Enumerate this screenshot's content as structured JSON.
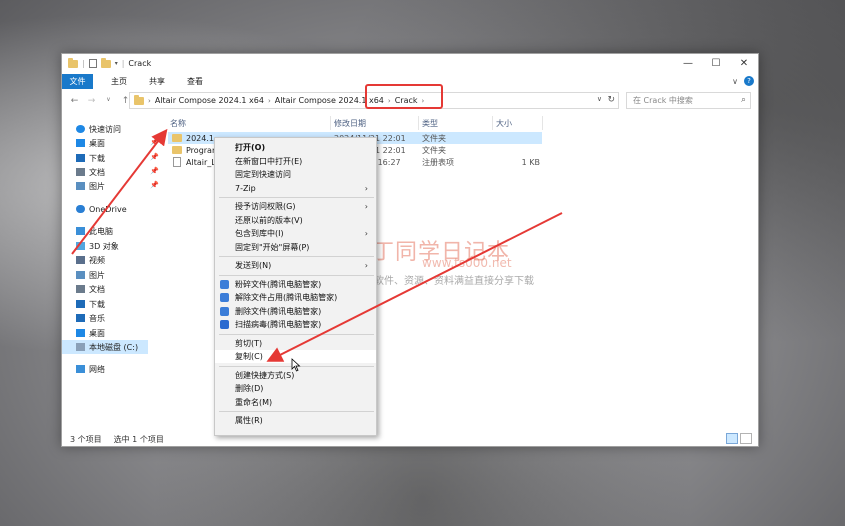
{
  "window": {
    "title": "Crack",
    "controls": {
      "minimize": "—",
      "maximize": "☐",
      "close": "✕"
    }
  },
  "ribbon": {
    "tabs": [
      "文件",
      "主页",
      "共享",
      "查看"
    ],
    "expand_icon": "∨",
    "help_icon": "?"
  },
  "address": {
    "crumbs": [
      "Altair Compose 2024.1 x64",
      "Altair Compose 2024.1 x64",
      "Crack"
    ],
    "search_placeholder": "在 Crack 中搜索"
  },
  "nav_pane": {
    "items": [
      {
        "label": "快速访问",
        "icon": "star-icon",
        "color": "#1e88e5"
      },
      {
        "label": "桌面",
        "icon": "desktop-icon",
        "color": "#1e88e5",
        "pinned": true
      },
      {
        "label": "下载",
        "icon": "download-icon",
        "color": "#1e6bb8",
        "pinned": true
      },
      {
        "label": "文档",
        "icon": "document-icon",
        "color": "#6b7b8c",
        "pinned": true
      },
      {
        "label": "图片",
        "icon": "pictures-icon",
        "color": "#5a8fc0",
        "pinned": true
      },
      {
        "label": "OneDrive",
        "icon": "cloud-icon",
        "color": "#2a7fd4"
      },
      {
        "label": "此电脑",
        "icon": "pc-icon",
        "color": "#3a8fd8"
      },
      {
        "label": "3D 对象",
        "icon": "cube-icon",
        "color": "#52a7e0"
      },
      {
        "label": "视频",
        "icon": "video-icon",
        "color": "#5a6f8c"
      },
      {
        "label": "图片",
        "icon": "pictures-icon",
        "color": "#5a8fc0"
      },
      {
        "label": "文档",
        "icon": "document-icon",
        "color": "#6b7b8c"
      },
      {
        "label": "下载",
        "icon": "download-icon",
        "color": "#1e6bb8"
      },
      {
        "label": "音乐",
        "icon": "music-icon",
        "color": "#1e6bb8"
      },
      {
        "label": "桌面",
        "icon": "desktop-icon",
        "color": "#1e88e5"
      },
      {
        "label": "本地磁盘 (C:)",
        "icon": "drive-icon",
        "color": "#8aa0b8",
        "selected": true
      },
      {
        "label": "网络",
        "icon": "network-icon",
        "color": "#3a8fd8"
      }
    ]
  },
  "file_list": {
    "columns": [
      "名称",
      "修改日期",
      "类型",
      "大小"
    ],
    "rows": [
      {
        "name": "2024.1",
        "date": "2024/11/21 22:01",
        "type": "文件夹",
        "size": "",
        "kind": "folder",
        "selected": true
      },
      {
        "name": "Program",
        "date": "2024/11/21 22:01",
        "type": "文件夹",
        "size": "",
        "kind": "folder"
      },
      {
        "name": "Altair_Li",
        "date": "2024/9/30 16:27",
        "type": "注册表项",
        "size": "1 KB",
        "kind": "file"
      }
    ]
  },
  "status": {
    "count": "3 个项目",
    "selected": "选中 1 个项目"
  },
  "context_menu": {
    "items": [
      {
        "label": "打开(O)",
        "bold": true
      },
      {
        "label": "在新窗口中打开(E)"
      },
      {
        "label": "固定到快速访问"
      },
      {
        "label": "7-Zip",
        "submenu": true
      },
      {
        "sep": true
      },
      {
        "label": "授予访问权限(G)",
        "submenu": true
      },
      {
        "label": "还原以前的版本(V)"
      },
      {
        "label": "包含到库中(I)",
        "submenu": true
      },
      {
        "label": "固定到\"开始\"屏幕(P)"
      },
      {
        "sep": true
      },
      {
        "label": "发送到(N)",
        "submenu": true
      },
      {
        "sep": true
      },
      {
        "label": "粉碎文件(腾讯电脑管家)",
        "icon_color": "#3b7dd8"
      },
      {
        "label": "解除文件占用(腾讯电脑管家)",
        "icon_color": "#3b7dd8"
      },
      {
        "label": "删除文件(腾讯电脑管家)",
        "icon_color": "#3b7dd8"
      },
      {
        "label": "扫描病毒(腾讯电脑管家)",
        "icon_color": "#2a6ad0"
      },
      {
        "sep": true
      },
      {
        "label": "剪切(T)"
      },
      {
        "label": "复制(C)",
        "highlight": true
      },
      {
        "sep": true
      },
      {
        "label": "创建快捷方式(S)"
      },
      {
        "label": "删除(D)"
      },
      {
        "label": "重命名(M)"
      },
      {
        "sep": true
      },
      {
        "label": "属性(R)"
      }
    ]
  },
  "watermark": {
    "title": "丁同学日记本",
    "url": "www.ts000.net",
    "subtitle": "软件、资源、资料满益直接分享下载"
  },
  "annotation_color": "#e53935"
}
